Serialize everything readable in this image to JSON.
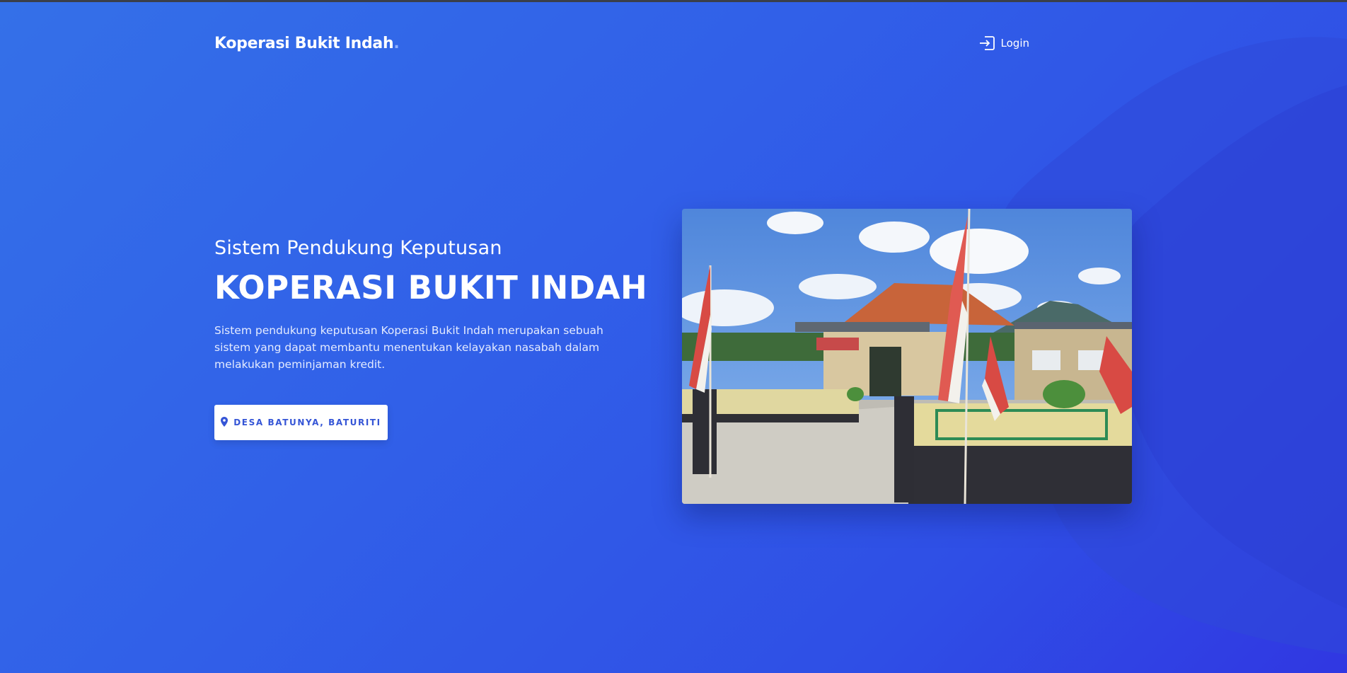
{
  "navbar": {
    "brand": "Koperasi Bukit Indah",
    "brand_dot": ".",
    "login_label": "Login",
    "login_icon": "sign-in-icon"
  },
  "hero": {
    "subtitle": "Sistem Pendukung Keputusan",
    "title": "KOPERASI BUKIT INDAH",
    "description": "Sistem pendukung keputusan Koperasi Bukit Indah merupakan sebuah sistem yang dapat membantu menentukan kelayakan nasabah dalam melakukan peminjaman kredit.",
    "location_button": "DESA BATUNYA, BATURITI",
    "location_icon": "map-marker-icon"
  },
  "photo": {
    "subject": "cooperative-office-building"
  },
  "colors": {
    "background_start": "#3470e8",
    "background_end": "#3037e2",
    "button_text": "#3555d6",
    "white": "#ffffff"
  }
}
